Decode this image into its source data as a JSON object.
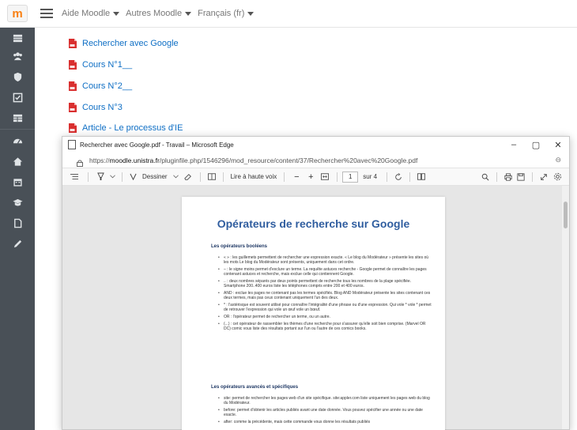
{
  "topbar": {
    "logo": "m",
    "menus": [
      "Aide Moodle",
      "Autres Moodle",
      "Français (fr)"
    ]
  },
  "sidebar": {
    "icons": [
      "dashboard-icon",
      "users-icon",
      "shield-icon",
      "checklist-icon",
      "table-icon",
      "tachometer-icon",
      "home-icon",
      "calendar-icon",
      "graduation-cap-icon",
      "file-icon",
      "pencil-icon"
    ]
  },
  "courses": [
    "Rechercher avec Google",
    "Cours N°1__",
    "Cours N°2__",
    "Cours N°3",
    "Article - Le processus d'IE"
  ],
  "edge": {
    "title": "Rechercher avec Google.pdf - Travail – Microsoft Edge",
    "url_prefix": "https://",
    "url_host": "moodle.unistra.fr",
    "url_path": "/pluginfile.php/1546296/mod_resource/content/37/Rechercher%20avec%20Google.pdf",
    "toolbar": {
      "draw": "Dessiner",
      "read_aloud": "Lire à haute voix",
      "minus": "−",
      "plus": "+",
      "page": "1",
      "of": "sur 4"
    }
  },
  "pdf": {
    "title": "Opérateurs de recherche sur Google",
    "section1": "Les opérateurs booléens",
    "section1_items": [
      "« » : les guillemets permettent de rechercher une expression exacte. « Le blog du Modérateur » présente les sites où les mots Le blog du Modérateur sont présents, uniquement dans cet ordre.",
      "– : le signe moins permet d'exclure un terme. La requête astuces recherche - Google permet de connaître les pages contenant astuces et recherche, mais exclue celle qui contiennent Google.",
      ".. : deux nombres séparés par deux points permettent de recherche tous les nombres de la plage spécifiée. Smartphone 200..400 euros liste les téléphones compris entre 200 et 400 euros.",
      "AND : exclue les pages ne contenant pas les termes spécifiés. Blog AND Modérateur présente les sites contenant ces deux termes, mais pas ceux contenant uniquement l'un des deux.",
      "* : l'astérisque est souvent utilisé pour connaître l'intégralité d'une phrase ou d'une expression. Qui vole * vole * permet de retrouver l'expression qui vole un œuf vole un bœuf.",
      "OR : l'opérateur permet de rechercher un terme, ou un autre.",
      "(...) : cet opérateur de rassembler les thèmes d'une recherche pour s'assurer qu'elle soit bien comprise. (Marvel OR DC) comic vous liste des résultats portant sur l'un ou l'autre de ces comics books."
    ],
    "section2": "Les opérateurs avancés et spécifiques",
    "section2_items": [
      "site: permet de rechercher les pages web d'un site spécifique. site:appler.com liste uniquement les pages web du blog du Modérateur.",
      "before: permet d'obtenir les articles publiés avant une date donnée. Vous pouvez spécifier une année ou une date exacte.",
      "after: comme la précédente, mais cette commande vous donne les résultats publiés"
    ]
  }
}
